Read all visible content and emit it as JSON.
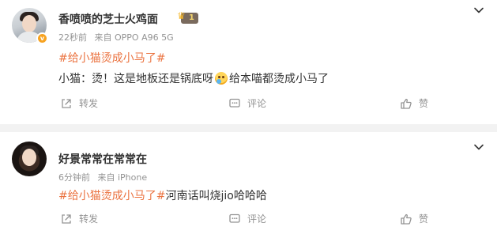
{
  "posts": [
    {
      "author": "香喷喷的芝士火鸡面",
      "time": "22秒前",
      "source": "来自 OPPO A96 5G",
      "topic": "#给小猫烫成小马了#",
      "text_before_emoji": "小猫：烫！这是地板还是锅底呀",
      "text_after_emoji": "给本喵都烫成小马了",
      "has_verified_badge": true,
      "vip_badge": "1",
      "share_label": "转发",
      "comment_label": "评论",
      "like_label": "赞"
    },
    {
      "author": "好景常常在常常在",
      "time": "6分钟前",
      "source": "来自 iPhone",
      "topic": "#给小猫烫成小马了#",
      "text": "河南话叫烧jio哈哈哈",
      "share_label": "转发",
      "comment_label": "评论",
      "like_label": "赞"
    }
  ],
  "icons": {
    "more": "chevron-down-icon",
    "share": "share-icon",
    "comment": "comment-icon",
    "like": "thumbs-up-icon"
  },
  "colors": {
    "topic": "#eb7340",
    "meta": "#939393",
    "text": "#333333",
    "verified_badge": "#f7a321"
  }
}
